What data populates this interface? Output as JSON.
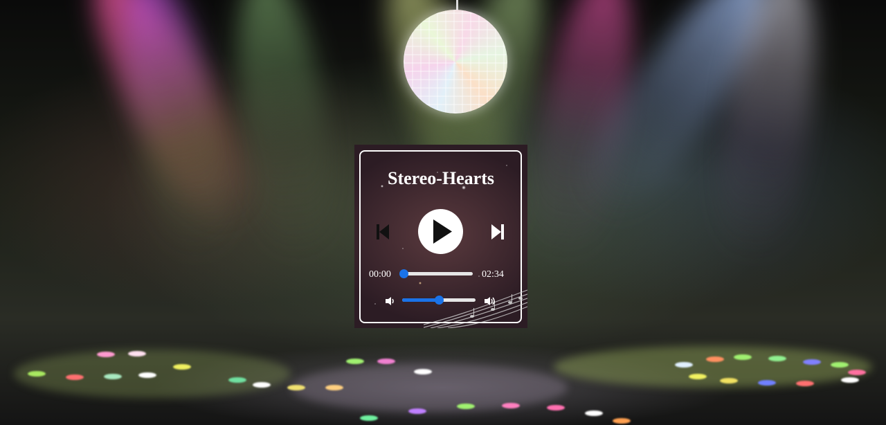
{
  "player": {
    "title": "Stereo-Hearts",
    "current_time": "00:00",
    "duration": "02:34",
    "progress_fraction": 0.0,
    "volume_fraction": 0.5,
    "is_playing": false
  },
  "icons": {
    "previous": "skip-previous-icon",
    "play": "play-icon",
    "next": "skip-next-icon",
    "volume_low": "volume-low-icon",
    "volume_high": "volume-high-icon",
    "disco_ball": "disco-ball"
  },
  "colors": {
    "accent": "#1a73e8",
    "frame": "#ffffff",
    "title": "#ffffff"
  }
}
